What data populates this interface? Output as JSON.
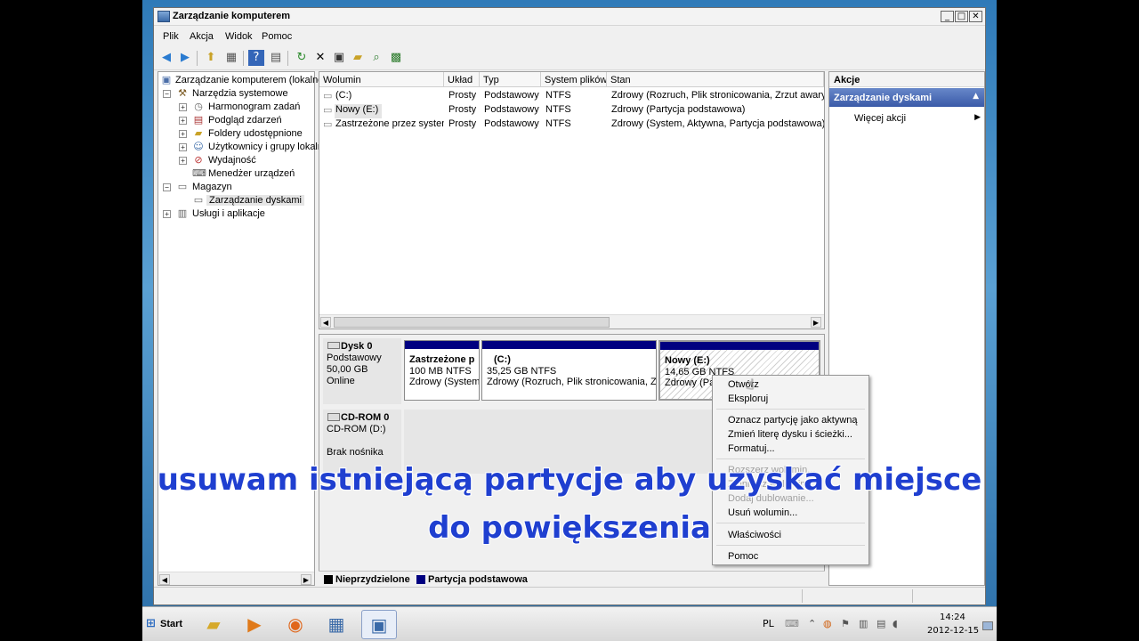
{
  "window": {
    "title": "Zarządzanie komputerem"
  },
  "menu": [
    "Plik",
    "Akcja",
    "Widok",
    "Pomoc"
  ],
  "tree": {
    "items": [
      {
        "label": "Zarządzanie komputerem (lokalne)",
        "icon": "computer-mgmt-icon"
      },
      {
        "label": "Narzędzia systemowe",
        "icon": "tools-icon"
      },
      {
        "label": "Harmonogram zadań",
        "icon": "clock-icon"
      },
      {
        "label": "Podgląd zdarzeń",
        "icon": "event-viewer-icon"
      },
      {
        "label": "Foldery udostępnione",
        "icon": "shared-folder-icon"
      },
      {
        "label": "Użytkownicy i grupy lokalne",
        "icon": "users-icon"
      },
      {
        "label": "Wydajność",
        "icon": "performance-icon"
      },
      {
        "label": "Menedżer urządzeń",
        "icon": "device-manager-icon"
      },
      {
        "label": "Magazyn",
        "icon": "storage-icon"
      },
      {
        "label": "Zarządzanie dyskami",
        "icon": "disk-mgmt-icon"
      },
      {
        "label": "Usługi i aplikacje",
        "icon": "services-icon"
      }
    ]
  },
  "volumes": {
    "columns": [
      "Wolumin",
      "Układ",
      "Typ",
      "System plików",
      "Stan"
    ],
    "rows": [
      [
        "(C:)",
        "Prosty",
        "Podstawowy",
        "NTFS",
        "Zdrowy (Rozruch, Plik stronicowania, Zrzut awaryjny"
      ],
      [
        "Nowy (E:)",
        "Prosty",
        "Podstawowy",
        "NTFS",
        "Zdrowy (Partycja podstawowa)"
      ],
      [
        "Zastrzeżone przez system",
        "Prosty",
        "Podstawowy",
        "NTFS",
        "Zdrowy (System, Aktywna, Partycja podstawowa)"
      ]
    ]
  },
  "disk0": {
    "name": "Dysk 0",
    "type": "Podstawowy",
    "size": "50,00 GB",
    "status": "Online",
    "partitions": [
      {
        "name": "Zastrzeżone p",
        "size": "100 MB NTFS",
        "status": "Zdrowy (System"
      },
      {
        "name": "(C:)",
        "size": "35,25 GB NTFS",
        "status": "Zdrowy (Rozruch, Plik stronicowania, Zrz"
      },
      {
        "name": "Nowy  (E:)",
        "size": "14,65 GB NTFS",
        "status": "Zdrowy (Par"
      }
    ]
  },
  "cdrom": {
    "name": "CD-ROM 0",
    "drive": "CD-ROM (D:)",
    "status": "Brak nośnika"
  },
  "legend": {
    "unallocated": "Nieprzydzielone",
    "primary": "Partycja podstawowa",
    "unallocated_color": "#000000",
    "primary_color": "#000080"
  },
  "actions": {
    "header": "Akcje",
    "section": "Zarządzanie dyskami",
    "more": "Więcej akcji"
  },
  "context_menu": {
    "items": [
      {
        "label": "Otwórz",
        "enabled": true
      },
      {
        "label": "Eksploruj",
        "enabled": true
      },
      {
        "label": "Oznacz partycję jako aktywną",
        "enabled": true
      },
      {
        "label": "Zmień literę dysku i ścieżki...",
        "enabled": true
      },
      {
        "label": "Formatuj...",
        "enabled": true
      },
      {
        "label": "Rozszerz wolumin...",
        "enabled": false
      },
      {
        "label": "Zmniejsz wolumin...",
        "enabled": false
      },
      {
        "label": "Dodaj dublowanie...",
        "enabled": false
      },
      {
        "label": "Usuń wolumin...",
        "enabled": true
      },
      {
        "label": "Właściwości",
        "enabled": true
      },
      {
        "label": "Pomoc",
        "enabled": true
      }
    ]
  },
  "caption": {
    "line1": "usuwam istniejącą partycje aby uzyskać miejsce",
    "line2": "do powiększenia"
  },
  "taskbar": {
    "start": "Start",
    "lang": "PL",
    "time": "14:24",
    "date": "2012-12-15"
  }
}
